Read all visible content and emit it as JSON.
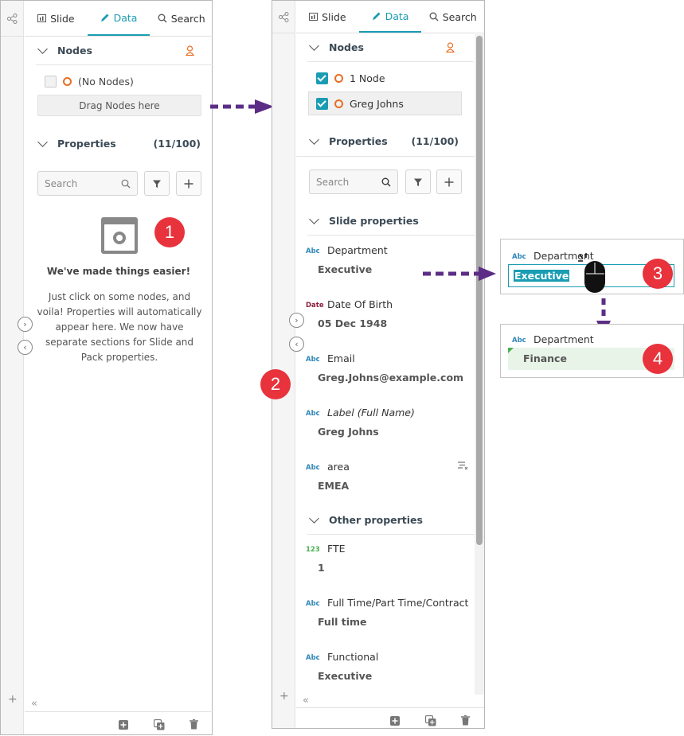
{
  "tabs": {
    "slide": "Slide",
    "data": "Data",
    "search": "Search"
  },
  "nodes_section": {
    "title": "Nodes"
  },
  "properties_section": {
    "title": "Properties",
    "count": "(11/100)"
  },
  "left_panel": {
    "no_nodes_label": "(No Nodes)",
    "drag_label": "Drag Nodes here",
    "search_placeholder": "Search",
    "empty_title": "We've made things easier!",
    "empty_body": "Just click on some nodes, and voila! Properties will automatically appear here. We now have separate sections for Slide and Pack properties."
  },
  "right_panel": {
    "nodes": [
      {
        "label": "1 Node",
        "checked": true
      },
      {
        "label": "Greg Johns",
        "checked": true
      }
    ],
    "search_placeholder": "Search",
    "slide_properties_title": "Slide properties",
    "other_properties_title": "Other properties",
    "slide_properties": [
      {
        "type": "Abc",
        "name": "Department",
        "value": "Executive"
      },
      {
        "type": "Date",
        "name": "Date Of Birth",
        "value": "05 Dec 1948"
      },
      {
        "type": "Abc",
        "name": "Email",
        "value": "Greg.Johns@example.com"
      },
      {
        "type": "Abc",
        "name": "Label (Full Name)",
        "value": "Greg Johns"
      },
      {
        "type": "Abc",
        "name": "area",
        "value": "EMEA"
      }
    ],
    "other_properties": [
      {
        "type": "123",
        "name": "FTE",
        "value": "1"
      },
      {
        "type": "Abc",
        "name": "Full Time/Part Time/Contract",
        "value": "Full time"
      },
      {
        "type": "Abc",
        "name": "Functional",
        "value": "Executive"
      }
    ]
  },
  "callout_edit": {
    "type": "Abc",
    "name": "Department",
    "value": "Executive"
  },
  "callout_result": {
    "type": "Abc",
    "name": "Department",
    "value": "Finance"
  },
  "badges": [
    "1",
    "2",
    "3",
    "4"
  ],
  "colors": {
    "accent": "#1a9db3",
    "node_ring": "#e86e22",
    "badge": "#e8323c",
    "arrow": "#5b2d86",
    "type_text": "#2f86b8",
    "number_type": "#4caf50"
  },
  "icons": [
    "share-icon",
    "slide-icon",
    "pencil-icon",
    "search-icon",
    "person-icon",
    "filter-icon",
    "plus-icon",
    "calendar-icon",
    "chevron-right-icon",
    "chevron-left-icon",
    "collapse-icon",
    "add-icon",
    "duplicate-icon",
    "trash-icon",
    "mouse-icon"
  ]
}
